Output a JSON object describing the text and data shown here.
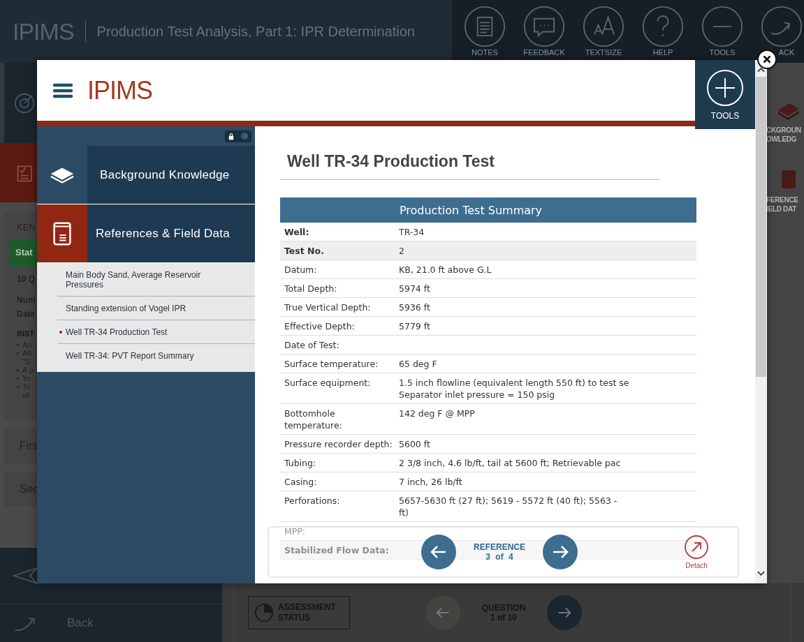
{
  "app_bar": {
    "logo": "IPIMS",
    "title": "Production Test Analysis, Part 1: IPR Determination",
    "tools": [
      {
        "label": "NOTES"
      },
      {
        "label": "FEEDBACK"
      },
      {
        "label": "TEXTSIZE"
      },
      {
        "label": "HELP"
      },
      {
        "label": "TOOLS"
      },
      {
        "label": "ACK"
      }
    ]
  },
  "background_left": {
    "name_fragment": "KEN",
    "status_fragment": "Stat",
    "count_fragment": "10 Q",
    "number_fragment": "Num",
    "date_fragment": "Date",
    "instructions_fragment": "INST",
    "instruction_lines": [
      {
        "text": "An",
        "bullet": true
      },
      {
        "text": "Aft",
        "bullet": true
      },
      {
        "text": "\"S",
        "bullet": false
      },
      {
        "text": "A p",
        "bullet": true
      },
      {
        "text": "Yo",
        "bullet": true
      },
      {
        "text": "To",
        "bullet": true
      },
      {
        "text": "all",
        "bullet": false
      }
    ],
    "questions": [
      "Firs",
      "Sec"
    ],
    "back": "Back"
  },
  "background_right": {
    "items": [
      {
        "lines": [
          "CKGROUN",
          "OWLEDG"
        ]
      },
      {
        "lines": [
          "FERENCE",
          "IELD DAT"
        ]
      }
    ]
  },
  "footer": {
    "assessment": "ASSESSMENT STATUS",
    "question_label": "QUESTION",
    "question_position": "1 of 10"
  },
  "modal": {
    "logo": "IPIMS",
    "tools_label": "TOOLS",
    "locked": true,
    "sections": [
      {
        "label": "Background Knowledge",
        "selected": false
      },
      {
        "label": "References & Field Data",
        "selected": true
      }
    ],
    "references": [
      {
        "label": "Main Body Sand, Average Reservoir Pressures",
        "selected": false
      },
      {
        "label": "Standing extension of Vogel IPR",
        "selected": false
      },
      {
        "label": "Well TR-34 Production Test",
        "selected": true
      },
      {
        "label": "Well TR-34: PVT Report Summary",
        "selected": false
      }
    ],
    "title": "Well TR-34 Production Test",
    "table": {
      "caption": "Production Test Summary",
      "rows": [
        {
          "key": "Well:",
          "lines": [
            "TR-34"
          ],
          "emphasis": true,
          "shaded": false
        },
        {
          "key": "Test No.",
          "lines": [
            "2"
          ],
          "emphasis": true,
          "shaded": true
        },
        {
          "key": "Datum:",
          "lines": [
            "KB, 21.0 ft above G.L"
          ],
          "emphasis": false,
          "shaded": false
        },
        {
          "key": "Total Depth:",
          "lines": [
            "5974 ft"
          ],
          "emphasis": false,
          "shaded": false
        },
        {
          "key": "True Vertical Depth:",
          "lines": [
            "5936 ft"
          ],
          "emphasis": false,
          "shaded": false
        },
        {
          "key": "Effective Depth:",
          "lines": [
            "5779 ft"
          ],
          "emphasis": false,
          "shaded": false
        },
        {
          "key": "Date of Test:",
          "emphasis": false,
          "shaded": false
        },
        {
          "key": "Surface temperature:",
          "lines": [
            "65 deg F"
          ],
          "emphasis": false,
          "shaded": false
        },
        {
          "key": "Surface equipment:",
          "lines": [
            "1.5 inch flowline (equivalent length 550 ft) to test se",
            "Separator inlet pressure = 150 psig"
          ],
          "emphasis": false,
          "shaded": false
        },
        {
          "key": "Bottomhole temperature:",
          "lines": [
            "142 deg F @ MPP"
          ],
          "emphasis": false,
          "shaded": false
        },
        {
          "key": "Pressure recorder depth:",
          "lines": [
            "5600 ft"
          ],
          "emphasis": false,
          "shaded": false
        },
        {
          "key": "Tubing:",
          "lines": [
            "2 3/8 inch, 4.6 lb/ft, tail at 5600 ft; Retrievable pac"
          ],
          "emphasis": false,
          "shaded": false
        },
        {
          "key": "Casing:",
          "lines": [
            "7 inch, 26 lb/ft"
          ],
          "emphasis": false,
          "shaded": false
        },
        {
          "key": "Perforations:",
          "lines": [
            "5657-5630 ft (27 ft); 5619 - 5572 ft (40 ft); 5563 -",
            "ft)"
          ],
          "emphasis": false,
          "shaded": false
        },
        {
          "key": "MPP:",
          "emphasis": false,
          "shaded": false
        },
        {
          "key": "Stabilized Flow Data:",
          "emphasis": true,
          "shaded": true
        }
      ]
    },
    "pager": {
      "label": "REFERENCE",
      "position": "3 of 4"
    },
    "detach": "Detach"
  }
}
